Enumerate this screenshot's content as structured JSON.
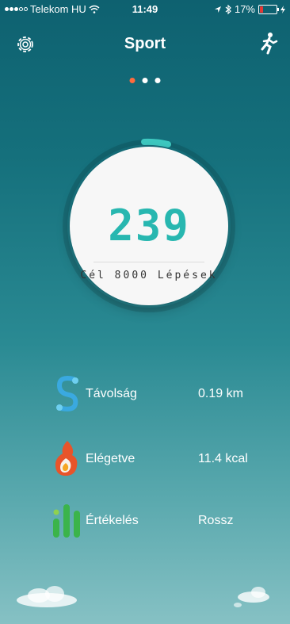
{
  "status_bar": {
    "carrier": "Telekom HU",
    "time": "11:49",
    "battery": "17%"
  },
  "nav": {
    "title": "Sport",
    "left_icon": "gear-icon",
    "right_icon": "runner-icon"
  },
  "pager": {
    "pages": 3,
    "active": 0
  },
  "progress": {
    "steps": "239",
    "goal_text": "Cél 8000 Lépések",
    "goal_value": 8000,
    "ring_color": "#3ec9c1"
  },
  "stats": [
    {
      "label": "Távolság",
      "value": "0.19 km",
      "icon": "distance-icon"
    },
    {
      "label": "Elégetve",
      "value": "11.4 kcal",
      "icon": "flame-icon"
    },
    {
      "label": "Értékelés",
      "value": "Rossz",
      "icon": "rating-bars-icon"
    }
  ],
  "colors": {
    "accent": "#28b7b0",
    "active_dot": "#ff6b3d"
  }
}
